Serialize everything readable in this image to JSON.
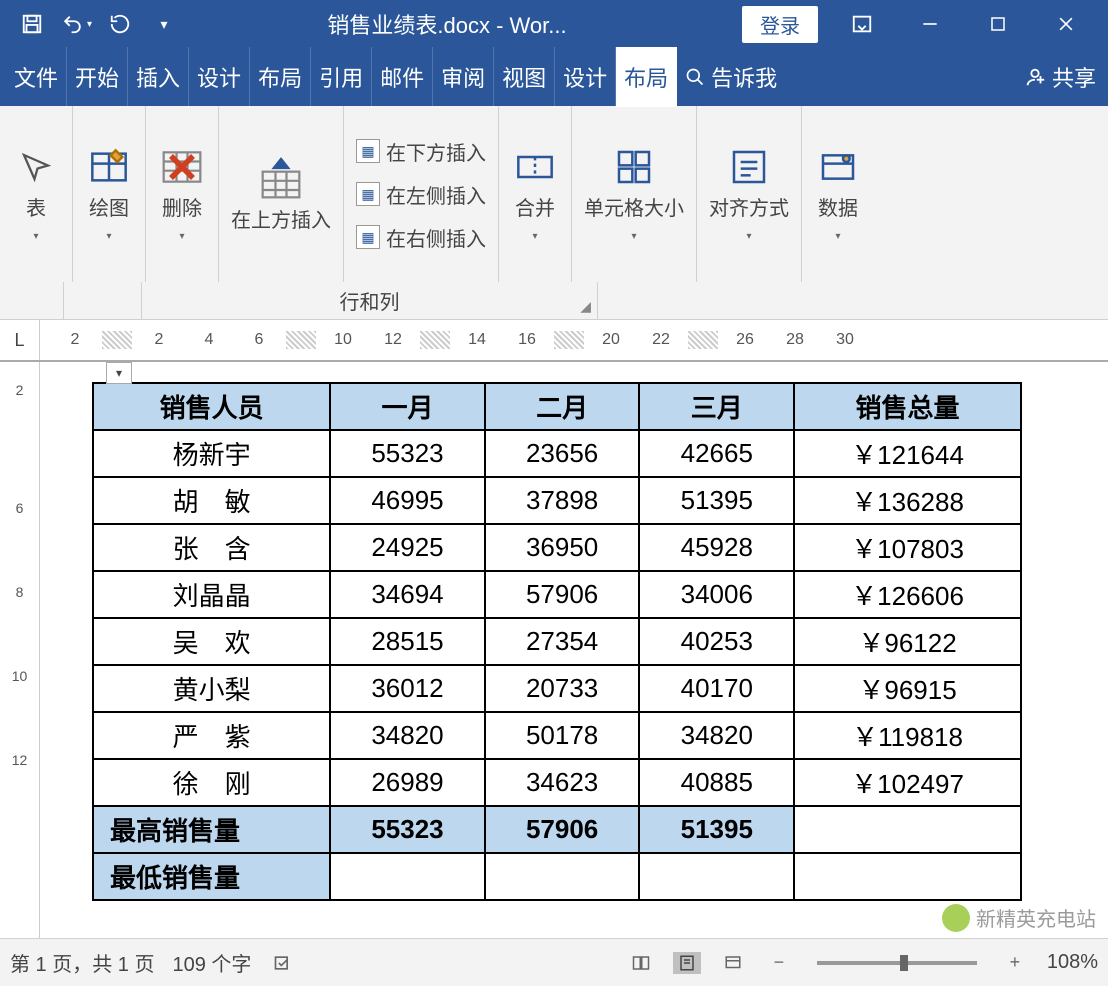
{
  "titlebar": {
    "title": "销售业绩表.docx - Wor...",
    "login": "登录"
  },
  "menu": {
    "file": "文件",
    "home": "开始",
    "insert": "插入",
    "design": "设计",
    "layout": "布局",
    "references": "引用",
    "mail": "邮件",
    "review": "审阅",
    "view": "视图",
    "table_design": "设计",
    "table_layout": "布局",
    "tellme": "告诉我",
    "share": "共享"
  },
  "ribbon": {
    "select": "表",
    "draw": "绘图",
    "delete": "删除",
    "insert_above": "在上方插入",
    "insert_below": "在下方插入",
    "insert_left": "在左侧插入",
    "insert_right": "在右侧插入",
    "merge": "合并",
    "cellsize": "单元格大小",
    "align": "对齐方式",
    "data": "数据",
    "rowscols": "行和列"
  },
  "ruler": {
    "h": [
      "2",
      "2",
      "4",
      "6",
      "10",
      "12",
      "14",
      "16",
      "20",
      "22",
      "26",
      "28",
      "30"
    ],
    "v": [
      "2",
      "",
      "",
      "6",
      "",
      "8",
      "",
      "10",
      "",
      "12"
    ]
  },
  "table": {
    "headers": [
      "销售人员",
      "一月",
      "二月",
      "三月",
      "销售总量"
    ],
    "rows": [
      {
        "name": "杨新宇",
        "m1": "55323",
        "m2": "23656",
        "m3": "42665",
        "total": "￥121644"
      },
      {
        "name": "胡　敏",
        "m1": "46995",
        "m2": "37898",
        "m3": "51395",
        "total": "￥136288"
      },
      {
        "name": "张　含",
        "m1": "24925",
        "m2": "36950",
        "m3": "45928",
        "total": "￥107803"
      },
      {
        "name": "刘晶晶",
        "m1": "34694",
        "m2": "57906",
        "m3": "34006",
        "total": "￥126606"
      },
      {
        "name": "吴　欢",
        "m1": "28515",
        "m2": "27354",
        "m3": "40253",
        "total": "￥96122"
      },
      {
        "name": "黄小梨",
        "m1": "36012",
        "m2": "20733",
        "m3": "40170",
        "total": "￥96915"
      },
      {
        "name": "严　紫",
        "m1": "34820",
        "m2": "50178",
        "m3": "34820",
        "total": "￥119818"
      },
      {
        "name": "徐　刚",
        "m1": "26989",
        "m2": "34623",
        "m3": "40885",
        "total": "￥102497"
      }
    ],
    "max_row": {
      "label": "最高销售量",
      "m1": "55323",
      "m2": "57906",
      "m3": "51395",
      "total": ""
    },
    "min_row": {
      "label": "最低销售量",
      "m1": "",
      "m2": "",
      "m3": "",
      "total": ""
    }
  },
  "status": {
    "page": "第 1 页，共 1 页",
    "words": "109 个字",
    "zoom": "108%"
  },
  "watermark": "新精英充电站"
}
